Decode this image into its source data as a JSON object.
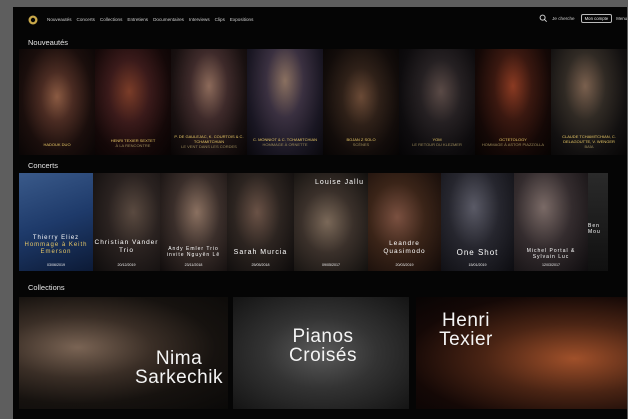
{
  "nav": [
    "Nouveautés",
    "Concerts",
    "Collections",
    "Entretiens",
    "Documentaires",
    "Interviews",
    "Clips",
    "Expositions"
  ],
  "search_label": "Je cherche",
  "btn_account": "Mon compte",
  "btn_menu": "Menu",
  "sections": {
    "nouveautes": "Nouveautés",
    "concerts": "Concerts",
    "collections": "Collections"
  },
  "nouveautes": [
    {
      "title": "Hadouk Duo",
      "sub": ""
    },
    {
      "title": "Henri Texier Sextet",
      "sub": "À la rencontre"
    },
    {
      "title": "P. de Gaulejac, K. Courtois & C. Tchamitchian",
      "sub": "Le vent dans les cordes"
    },
    {
      "title": "C. Monniot & C. Tchamitchian",
      "sub": "Hommage à Ornette"
    },
    {
      "title": "Bojan Z Solo",
      "sub": "Scènes"
    },
    {
      "title": "Yom",
      "sub": "Le retour du Klezmer"
    },
    {
      "title": "Octetology",
      "sub": "Hommage à Astor Piazzolla"
    },
    {
      "title": "Claude Tchamitchian, C. Delagoutte, V. Wenger",
      "sub": "Baïa"
    }
  ],
  "concerts": [
    {
      "title": "Thierry Eliez",
      "sub": "Hommage à Keith Emerson",
      "date": "03/06/2019"
    },
    {
      "title": "Christian Vander Trio",
      "sub": "",
      "date": "20/12/2019"
    },
    {
      "title": "Andy Emler Trio invite Nguyên Lê",
      "sub": "",
      "date": "23/11/2018"
    },
    {
      "title": "Sarah Murcia",
      "sub": "",
      "date": "25/05/2018"
    },
    {
      "title": "Louise Jallu",
      "sub": "",
      "date": "09/05/2017"
    },
    {
      "title": "Leandre Quasimodo",
      "sub": "",
      "date": "20/03/2019"
    },
    {
      "title": "One Shot",
      "sub": "",
      "date": "15/01/2019"
    },
    {
      "title": "Michel Portal & Sylvain Luc",
      "sub": "",
      "date": "12/03/2017"
    },
    {
      "title": "Ben Mou",
      "sub": "",
      "date": ""
    }
  ],
  "collections": [
    "Nima Sarkechik",
    "Pianos Croisés",
    "Henri Texier"
  ],
  "colors": {
    "gold": "#e8c866",
    "background": "#050505"
  }
}
